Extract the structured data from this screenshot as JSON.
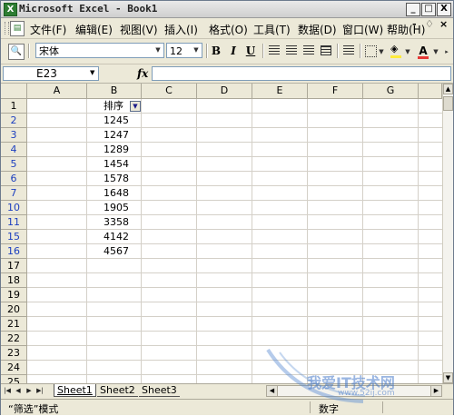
{
  "window": {
    "title": "Microsoft Excel - Book1",
    "app_icon": "excel-icon",
    "controls": {
      "minimize": "_",
      "restore": "□",
      "close": "X"
    },
    "mdi_controls": {
      "minimize": "-",
      "restore": "♢",
      "close": "×"
    }
  },
  "menu": {
    "items": [
      "文件(F)",
      "编辑(E)",
      "视图(V)",
      "插入(I)",
      "格式(O)",
      "工具(T)",
      "数据(D)",
      "窗口(W)",
      "帮助(H)"
    ]
  },
  "toolbar": {
    "font_name": "宋体",
    "font_size": "12",
    "bold": "B",
    "italic": "I",
    "underline": "U",
    "font_color_glyph": "A"
  },
  "formula_bar": {
    "name_box": "E23",
    "fx": "fx",
    "formula": ""
  },
  "grid": {
    "columns": [
      "A",
      "B",
      "C",
      "D",
      "E",
      "F",
      "G"
    ],
    "rows": [
      {
        "num": "1",
        "filtered": false,
        "b": "排序",
        "header": true
      },
      {
        "num": "2",
        "filtered": true,
        "b": "1245"
      },
      {
        "num": "3",
        "filtered": true,
        "b": "1247"
      },
      {
        "num": "4",
        "filtered": true,
        "b": "1289"
      },
      {
        "num": "5",
        "filtered": true,
        "b": "1454"
      },
      {
        "num": "6",
        "filtered": true,
        "b": "1578"
      },
      {
        "num": "7",
        "filtered": true,
        "b": "1648"
      },
      {
        "num": "10",
        "filtered": true,
        "b": "1905"
      },
      {
        "num": "11",
        "filtered": true,
        "b": "3358"
      },
      {
        "num": "15",
        "filtered": true,
        "b": "4142"
      },
      {
        "num": "16",
        "filtered": true,
        "b": "4567"
      },
      {
        "num": "17",
        "filtered": false,
        "b": ""
      },
      {
        "num": "18",
        "filtered": false,
        "b": ""
      },
      {
        "num": "19",
        "filtered": false,
        "b": ""
      },
      {
        "num": "20",
        "filtered": false,
        "b": ""
      },
      {
        "num": "21",
        "filtered": false,
        "b": ""
      },
      {
        "num": "22",
        "filtered": false,
        "b": ""
      },
      {
        "num": "23",
        "filtered": false,
        "b": ""
      },
      {
        "num": "24",
        "filtered": false,
        "b": ""
      },
      {
        "num": "25",
        "filtered": false,
        "b": ""
      }
    ],
    "filter_icon": "dropdown-arrow-icon"
  },
  "sheets": {
    "tabs": [
      "Sheet1",
      "Sheet2",
      "Sheet3"
    ],
    "active": "Sheet1"
  },
  "status": {
    "left": "“筛选”模式",
    "mode": "数字"
  },
  "watermark": {
    "text": "我爱IT技术网",
    "url": "www.52ij.com"
  },
  "colors": {
    "chrome": "#ece9d8",
    "filtered_row_number": "#1c3fbf",
    "grid_line": "#d4d0c8"
  }
}
